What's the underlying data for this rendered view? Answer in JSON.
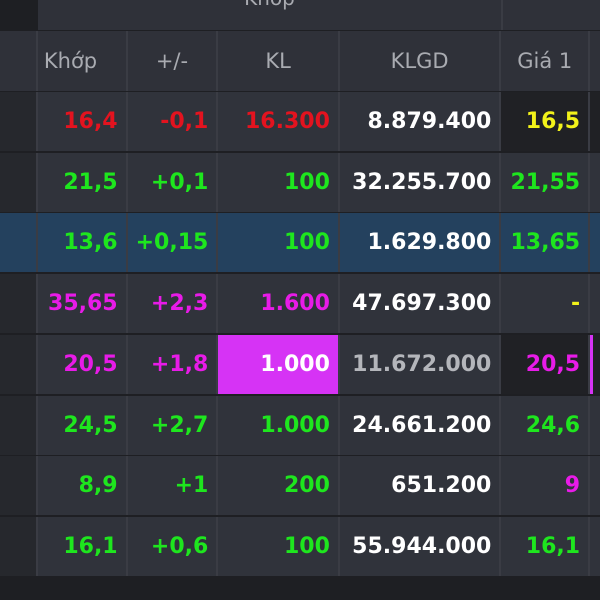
{
  "header": {
    "group_label": "Khớp",
    "columns": [
      "Khớp",
      "+/-",
      "KL",
      "KLGD",
      "Giá 1"
    ]
  },
  "colors": {
    "red": "#e3131f",
    "green": "#1ee61e",
    "magenta": "#e81be8",
    "yellow": "#f2f21a",
    "white": "#ffffff",
    "gray": "#b4b6bb",
    "highlight": "#d633f5",
    "selected_row": "#24415e"
  },
  "rows": [
    {
      "khop": "16,4",
      "change": "-0,1",
      "kl": "16.300",
      "klgd": "8.879.400",
      "gia1": "16,5",
      "c": "red",
      "gc": "yellow",
      "dark": true
    },
    {
      "khop": "21,5",
      "change": "+0,1",
      "kl": "100",
      "klgd": "32.255.700",
      "gia1": "21,55",
      "c": "green",
      "gc": "green"
    },
    {
      "khop": "13,6",
      "change": "+0,15",
      "kl": "100",
      "klgd": "1.629.800",
      "gia1": "13,65",
      "c": "green",
      "gc": "green",
      "selected": true
    },
    {
      "khop": "35,65",
      "change": "+2,3",
      "kl": "1.600",
      "klgd": "47.697.300",
      "gia1": "-",
      "c": "magenta",
      "gc": "yellow"
    },
    {
      "khop": "20,5",
      "change": "+1,8",
      "kl": "1.000",
      "klgd": "11.672.000",
      "gia1": "20,5",
      "c": "magenta",
      "gc": "magenta",
      "dark": true,
      "kl_highlight": true,
      "klgd_gray": true
    },
    {
      "khop": "24,5",
      "change": "+2,7",
      "kl": "1.000",
      "klgd": "24.661.200",
      "gia1": "24,6",
      "c": "green",
      "gc": "green"
    },
    {
      "khop": "8,9",
      "change": "+1",
      "kl": "200",
      "klgd": "651.200",
      "gia1": "9",
      "c": "green",
      "gc": "magenta"
    },
    {
      "khop": "16,1",
      "change": "+0,6",
      "kl": "100",
      "klgd": "55.944.000",
      "gia1": "16,1",
      "c": "green",
      "gc": "green"
    }
  ]
}
